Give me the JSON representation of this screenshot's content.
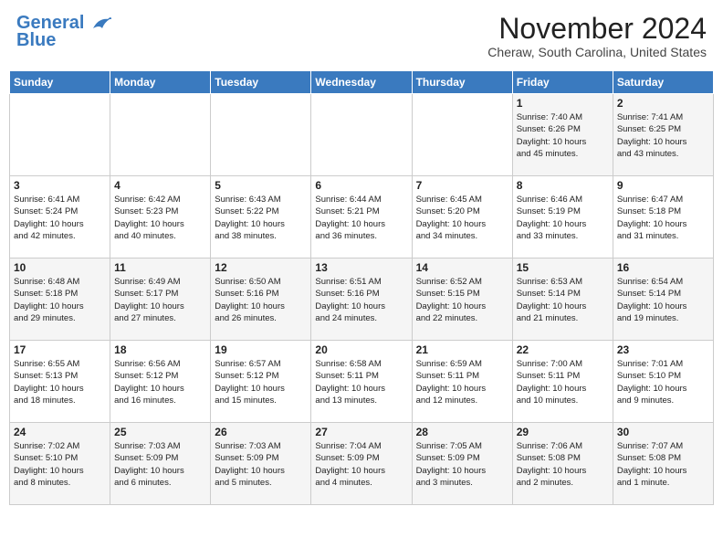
{
  "header": {
    "logo_general": "General",
    "logo_blue": "Blue",
    "month_title": "November 2024",
    "location": "Cheraw, South Carolina, United States"
  },
  "days_of_week": [
    "Sunday",
    "Monday",
    "Tuesday",
    "Wednesday",
    "Thursday",
    "Friday",
    "Saturday"
  ],
  "weeks": [
    [
      {
        "day": "",
        "info": ""
      },
      {
        "day": "",
        "info": ""
      },
      {
        "day": "",
        "info": ""
      },
      {
        "day": "",
        "info": ""
      },
      {
        "day": "",
        "info": ""
      },
      {
        "day": "1",
        "info": "Sunrise: 7:40 AM\nSunset: 6:26 PM\nDaylight: 10 hours\nand 45 minutes."
      },
      {
        "day": "2",
        "info": "Sunrise: 7:41 AM\nSunset: 6:25 PM\nDaylight: 10 hours\nand 43 minutes."
      }
    ],
    [
      {
        "day": "3",
        "info": "Sunrise: 6:41 AM\nSunset: 5:24 PM\nDaylight: 10 hours\nand 42 minutes."
      },
      {
        "day": "4",
        "info": "Sunrise: 6:42 AM\nSunset: 5:23 PM\nDaylight: 10 hours\nand 40 minutes."
      },
      {
        "day": "5",
        "info": "Sunrise: 6:43 AM\nSunset: 5:22 PM\nDaylight: 10 hours\nand 38 minutes."
      },
      {
        "day": "6",
        "info": "Sunrise: 6:44 AM\nSunset: 5:21 PM\nDaylight: 10 hours\nand 36 minutes."
      },
      {
        "day": "7",
        "info": "Sunrise: 6:45 AM\nSunset: 5:20 PM\nDaylight: 10 hours\nand 34 minutes."
      },
      {
        "day": "8",
        "info": "Sunrise: 6:46 AM\nSunset: 5:19 PM\nDaylight: 10 hours\nand 33 minutes."
      },
      {
        "day": "9",
        "info": "Sunrise: 6:47 AM\nSunset: 5:18 PM\nDaylight: 10 hours\nand 31 minutes."
      }
    ],
    [
      {
        "day": "10",
        "info": "Sunrise: 6:48 AM\nSunset: 5:18 PM\nDaylight: 10 hours\nand 29 minutes."
      },
      {
        "day": "11",
        "info": "Sunrise: 6:49 AM\nSunset: 5:17 PM\nDaylight: 10 hours\nand 27 minutes."
      },
      {
        "day": "12",
        "info": "Sunrise: 6:50 AM\nSunset: 5:16 PM\nDaylight: 10 hours\nand 26 minutes."
      },
      {
        "day": "13",
        "info": "Sunrise: 6:51 AM\nSunset: 5:16 PM\nDaylight: 10 hours\nand 24 minutes."
      },
      {
        "day": "14",
        "info": "Sunrise: 6:52 AM\nSunset: 5:15 PM\nDaylight: 10 hours\nand 22 minutes."
      },
      {
        "day": "15",
        "info": "Sunrise: 6:53 AM\nSunset: 5:14 PM\nDaylight: 10 hours\nand 21 minutes."
      },
      {
        "day": "16",
        "info": "Sunrise: 6:54 AM\nSunset: 5:14 PM\nDaylight: 10 hours\nand 19 minutes."
      }
    ],
    [
      {
        "day": "17",
        "info": "Sunrise: 6:55 AM\nSunset: 5:13 PM\nDaylight: 10 hours\nand 18 minutes."
      },
      {
        "day": "18",
        "info": "Sunrise: 6:56 AM\nSunset: 5:12 PM\nDaylight: 10 hours\nand 16 minutes."
      },
      {
        "day": "19",
        "info": "Sunrise: 6:57 AM\nSunset: 5:12 PM\nDaylight: 10 hours\nand 15 minutes."
      },
      {
        "day": "20",
        "info": "Sunrise: 6:58 AM\nSunset: 5:11 PM\nDaylight: 10 hours\nand 13 minutes."
      },
      {
        "day": "21",
        "info": "Sunrise: 6:59 AM\nSunset: 5:11 PM\nDaylight: 10 hours\nand 12 minutes."
      },
      {
        "day": "22",
        "info": "Sunrise: 7:00 AM\nSunset: 5:11 PM\nDaylight: 10 hours\nand 10 minutes."
      },
      {
        "day": "23",
        "info": "Sunrise: 7:01 AM\nSunset: 5:10 PM\nDaylight: 10 hours\nand 9 minutes."
      }
    ],
    [
      {
        "day": "24",
        "info": "Sunrise: 7:02 AM\nSunset: 5:10 PM\nDaylight: 10 hours\nand 8 minutes."
      },
      {
        "day": "25",
        "info": "Sunrise: 7:03 AM\nSunset: 5:09 PM\nDaylight: 10 hours\nand 6 minutes."
      },
      {
        "day": "26",
        "info": "Sunrise: 7:03 AM\nSunset: 5:09 PM\nDaylight: 10 hours\nand 5 minutes."
      },
      {
        "day": "27",
        "info": "Sunrise: 7:04 AM\nSunset: 5:09 PM\nDaylight: 10 hours\nand 4 minutes."
      },
      {
        "day": "28",
        "info": "Sunrise: 7:05 AM\nSunset: 5:09 PM\nDaylight: 10 hours\nand 3 minutes."
      },
      {
        "day": "29",
        "info": "Sunrise: 7:06 AM\nSunset: 5:08 PM\nDaylight: 10 hours\nand 2 minutes."
      },
      {
        "day": "30",
        "info": "Sunrise: 7:07 AM\nSunset: 5:08 PM\nDaylight: 10 hours\nand 1 minute."
      }
    ]
  ]
}
